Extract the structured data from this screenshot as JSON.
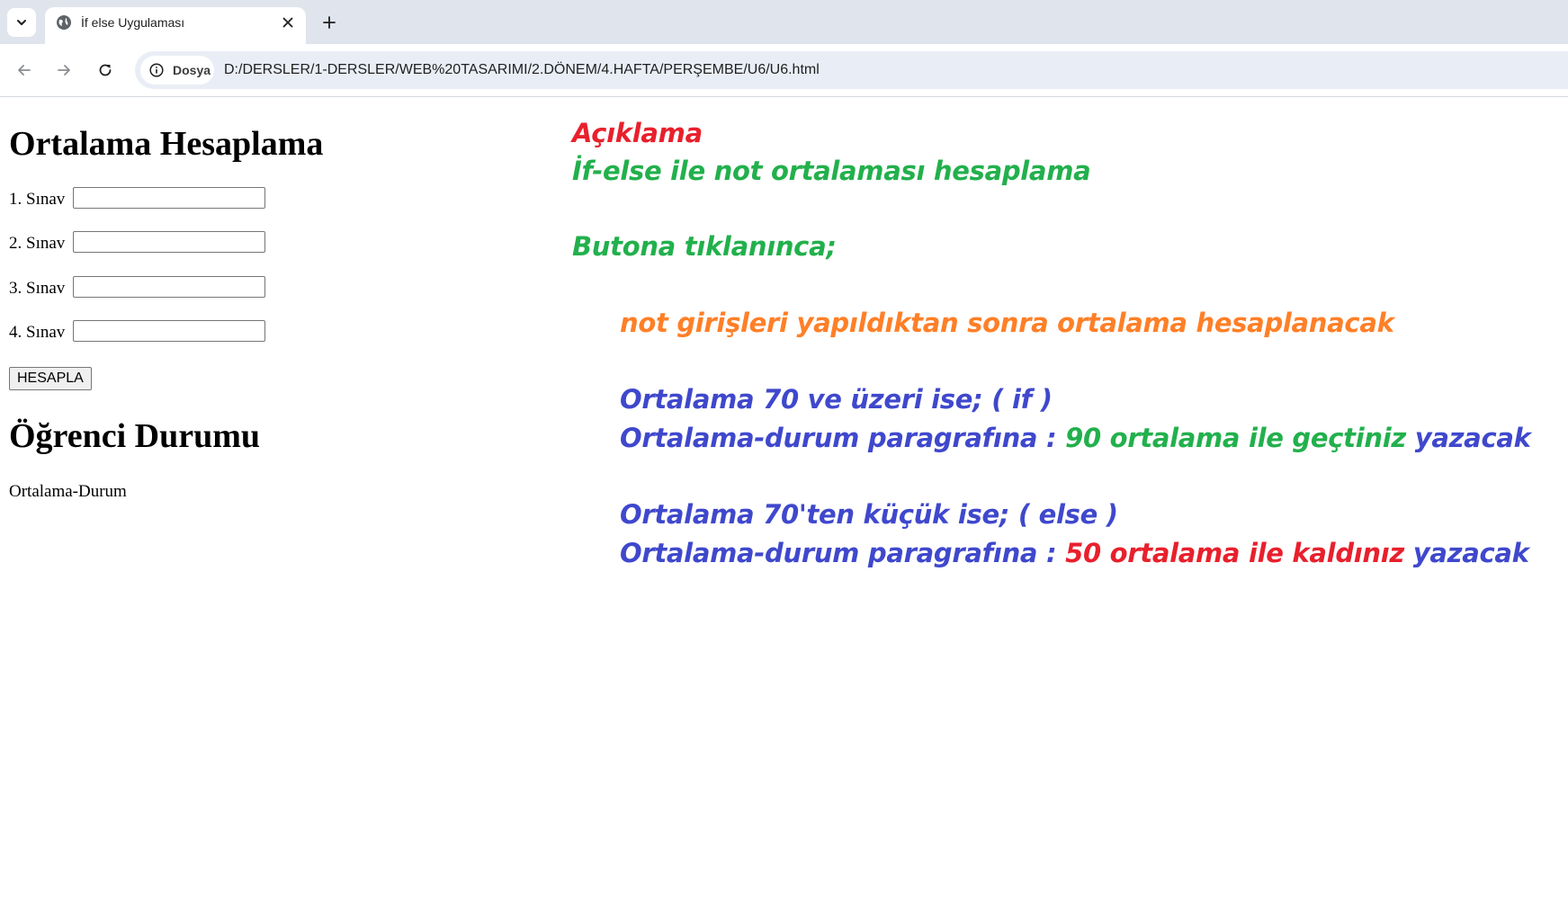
{
  "browser": {
    "tab_title": "İf else Uygulaması",
    "site_chip": "Dosya",
    "url": "D:/DERSLER/1-DERSLER/WEB%20TASARIMI/2.DÖNEM/4.HAFTA/PERŞEMBE/U6/U6.html"
  },
  "colors": {
    "red": "#e8202c",
    "green": "#22b04c",
    "orange": "#ff7f27",
    "blue": "#3f48cc"
  },
  "form": {
    "title": "Ortalama Hesaplama",
    "fields": [
      {
        "label": "1. Sınav",
        "value": ""
      },
      {
        "label": "2. Sınav",
        "value": ""
      },
      {
        "label": "3. Sınav",
        "value": ""
      },
      {
        "label": "4. Sınav",
        "value": ""
      }
    ],
    "button_label": "HESAPLA"
  },
  "status": {
    "title": "Öğrenci Durumu",
    "text": "Ortalama-Durum"
  },
  "notes": {
    "heading": "Açıklama",
    "subtitle": "İf-else ile not ortalaması hesaplama",
    "on_click": "Butona tıklanınca;",
    "step1": "not girişleri yapıldıktan sonra ortalama hesaplanacak",
    "if_line": "Ortalama 70 ve üzeri ise; ( if )",
    "if_prefix": "Ortalama-durum paragrafına : ",
    "if_message": "90 ortalama ile geçtiniz",
    "if_suffix": " yazacak",
    "else_line": "Ortalama 70'ten küçük ise; ( else )",
    "else_prefix": "Ortalama-durum paragrafına : ",
    "else_message": "50 ortalama ile kaldınız",
    "else_suffix": " yazacak"
  }
}
